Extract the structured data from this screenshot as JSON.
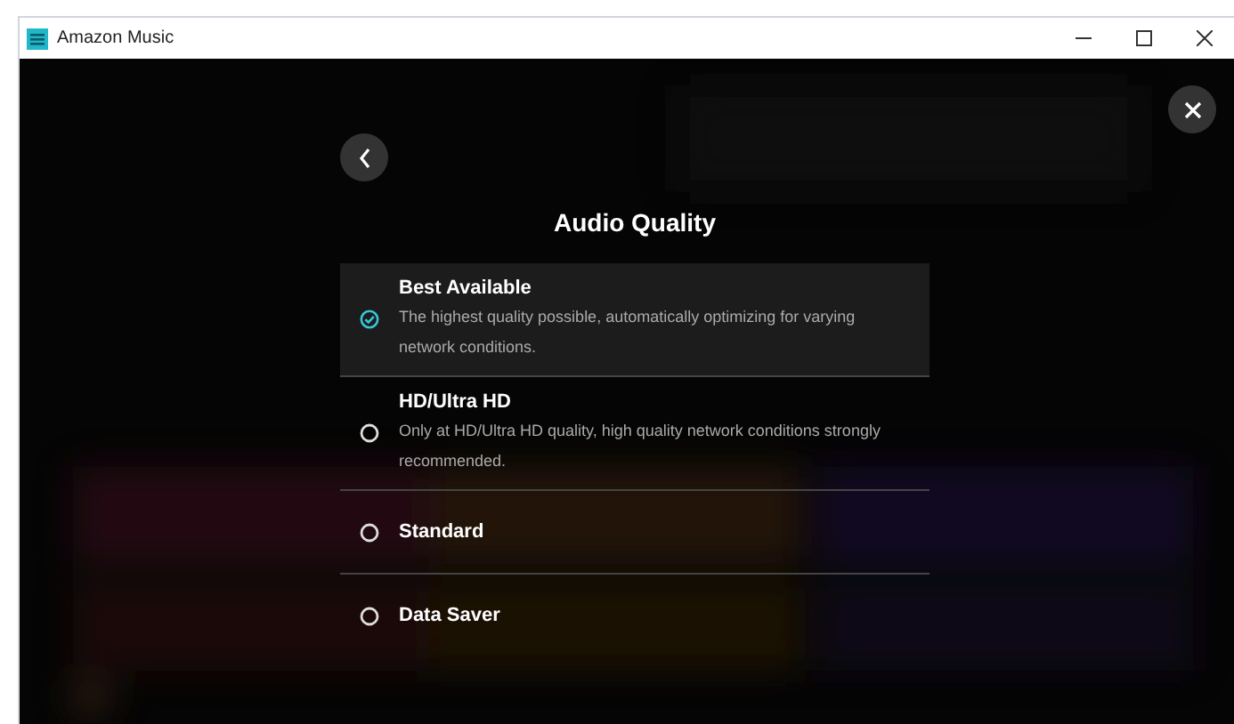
{
  "window": {
    "title": "Amazon Music"
  },
  "dialog": {
    "title": "Audio Quality",
    "options": [
      {
        "label": "Best Available",
        "description": "The highest quality possible, automatically optimizing for varying network conditions.",
        "selected": true
      },
      {
        "label": "HD/Ultra HD",
        "description": "Only at HD/Ultra HD quality, high quality network conditions strongly recommended.",
        "selected": false
      },
      {
        "label": "Standard",
        "selected": false
      },
      {
        "label": "Data Saver",
        "selected": false
      }
    ]
  }
}
